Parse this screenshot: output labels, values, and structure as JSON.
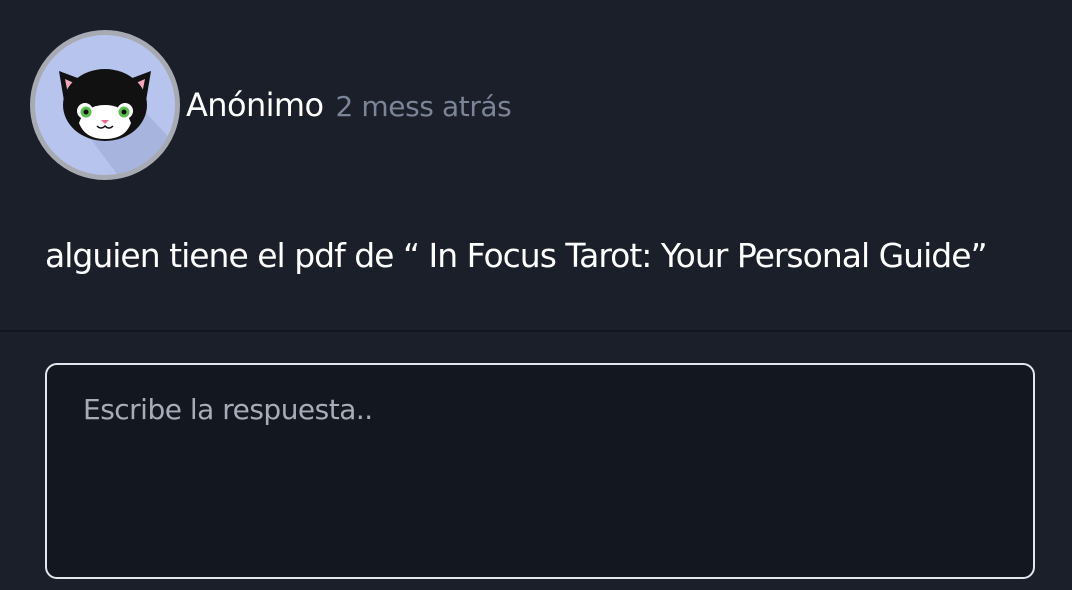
{
  "post": {
    "author": "Anónimo",
    "timestamp": "2 mess atrás",
    "avatar_icon": "black-cat-avatar-icon",
    "question": "alguien tiene el pdf de “ In Focus Tarot: Your Personal Guide”"
  },
  "reply": {
    "placeholder": "Escribe la respuesta..",
    "value": ""
  },
  "colors": {
    "background": "#1a1f29",
    "avatar_background": "#b7c5ee",
    "input_border": "#e3e6ec",
    "timestamp": "#7b8597"
  }
}
